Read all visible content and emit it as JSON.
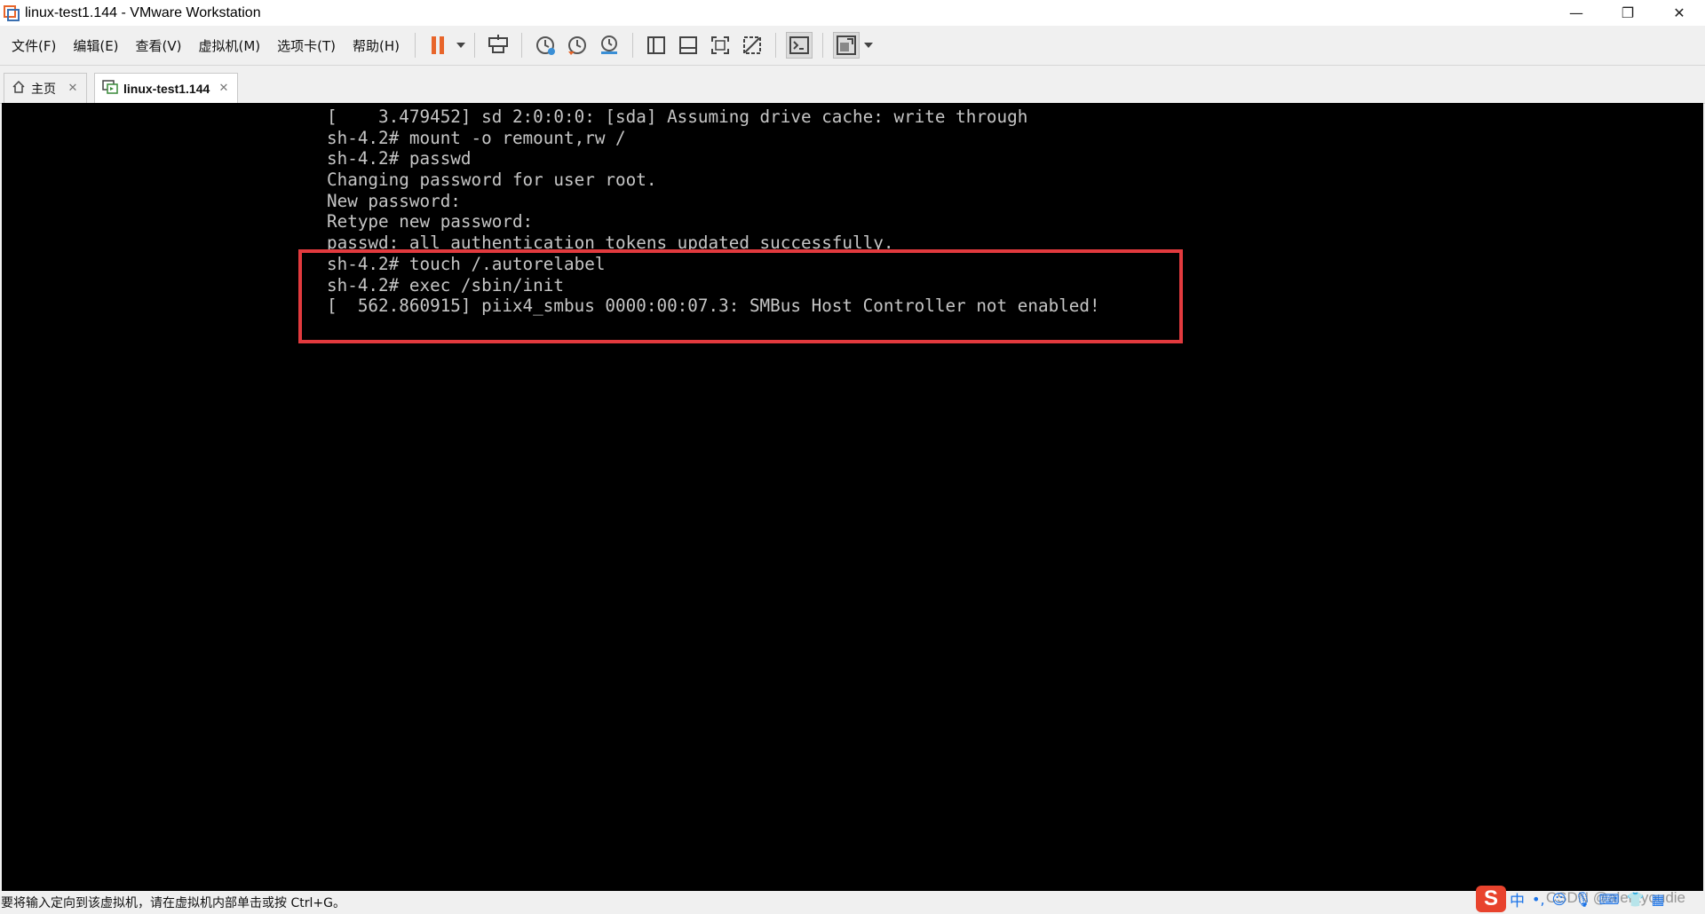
{
  "window": {
    "title": "linux-test1.144 - VMware Workstation",
    "controls": {
      "minimize": "—",
      "restore": "❐",
      "close": "✕"
    }
  },
  "menu": {
    "items": [
      "文件(F)",
      "编辑(E)",
      "查看(V)",
      "虚拟机(M)",
      "选项卡(T)",
      "帮助(H)"
    ]
  },
  "toolbar": {
    "icons": [
      "pause-icon",
      "dropdown-arrow-icon",
      "send-ctrl-alt-del-icon",
      "snapshot-icon",
      "revert-snapshot-icon",
      "snapshot-manager-icon",
      "show-library-icon",
      "show-thumbnail-icon",
      "full-screen-icon",
      "unity-icon",
      "console-view-icon",
      "stretch-view-icon"
    ],
    "accent": "#e8652a"
  },
  "tabs": [
    {
      "label": "主页",
      "close": "✕",
      "icon": "home-icon"
    },
    {
      "label": "linux-test1.144",
      "close": "✕",
      "icon": "vm-icon"
    }
  ],
  "console": {
    "lines": [
      "[    3.479452] sd 2:0:0:0: [sda] Assuming drive cache: write through",
      "sh-4.2# mount -o remount,rw /",
      "sh-4.2# passwd",
      "Changing password for user root.",
      "New password:",
      "Retype new password:",
      "passwd: all authentication tokens updated successfully.",
      "sh-4.2# touch /.autorelabel",
      "sh-4.2# exec /sbin/init",
      "[  562.860915] piix4_smbus 0000:00:07.3: SMBus Host Controller not enabled!"
    ],
    "highlight_color": "#e23a3e"
  },
  "status": {
    "text": "要将输入定向到该虚拟机，请在虚拟机内部单击或按 Ctrl+G。"
  },
  "tray": {
    "ime_logo": "S",
    "ime_mode": "中",
    "punct": "•,",
    "icons": [
      "emoji-icon",
      "microphone-icon",
      "keyboard-icon",
      "skin-icon",
      "grid-icon"
    ]
  },
  "watermark": "CSDN @alentyoudie"
}
